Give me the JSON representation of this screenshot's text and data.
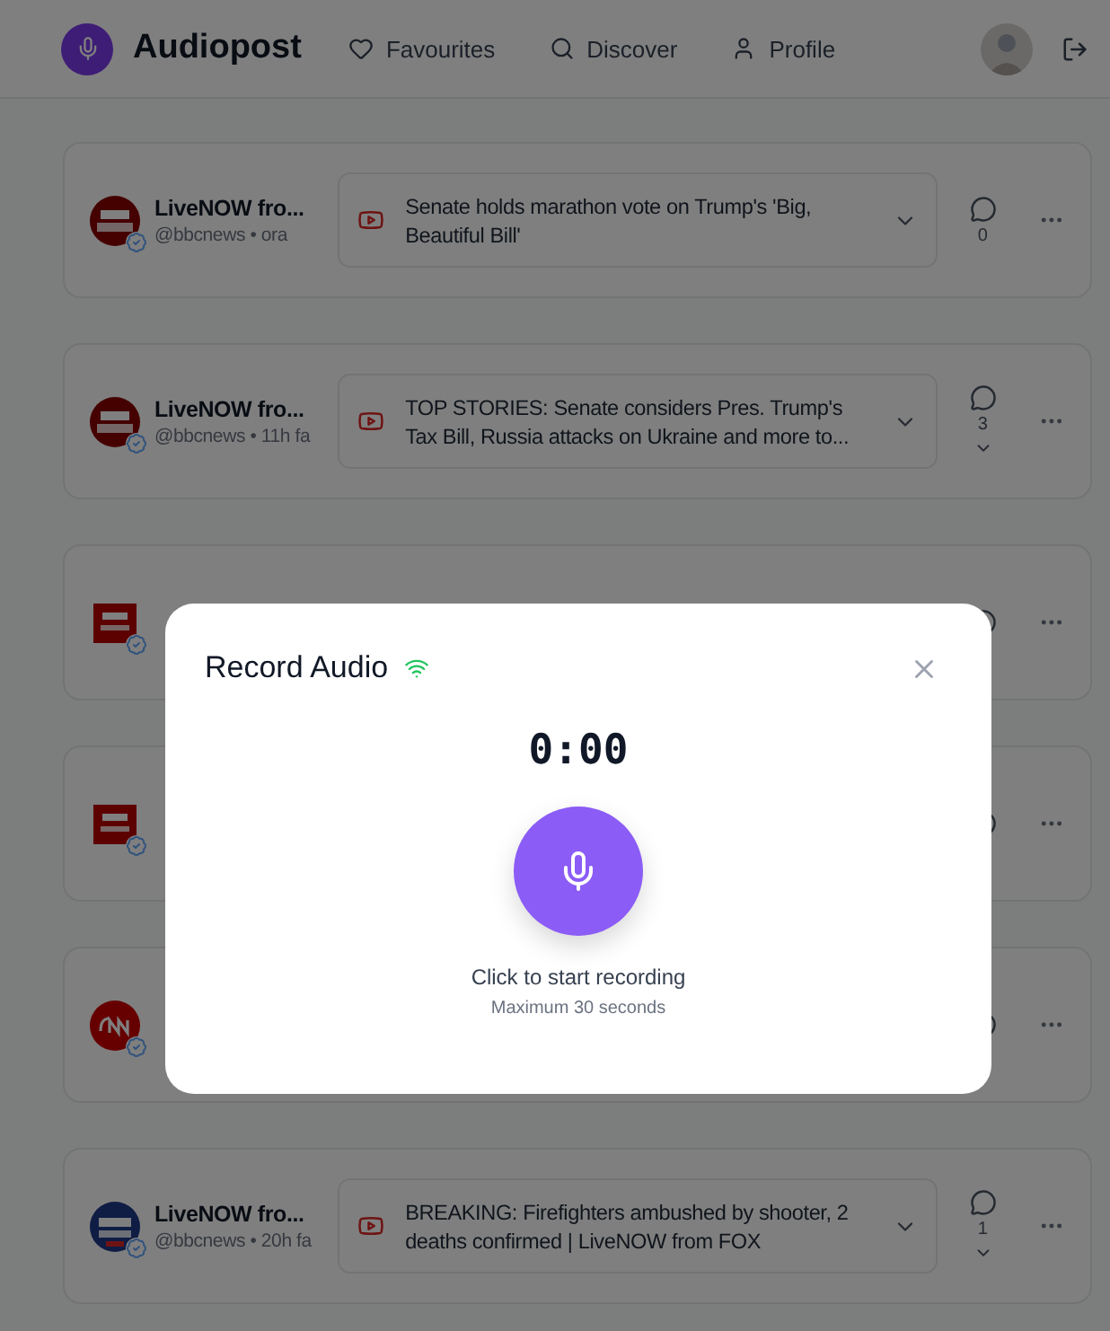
{
  "header": {
    "brand": "Audiopost",
    "nav": [
      {
        "label": "Favourites"
      },
      {
        "label": "Discover"
      },
      {
        "label": "Profile"
      }
    ]
  },
  "posts": [
    {
      "kind": "bbc-circle",
      "name": "LiveNOW fro...",
      "meta": "@bbcnews • ora",
      "headline": "Senate holds marathon vote on Trump's 'Big, Beautiful Bill'",
      "count": "0",
      "has_replies": false
    },
    {
      "kind": "bbc-circle",
      "name": "LiveNOW fro...",
      "meta": "@bbcnews • 11h fa",
      "headline": "TOP STORIES: Senate considers Pres. Trump's Tax Bill, Russia attacks on Ukraine and more to...",
      "count": "3",
      "has_replies": true
    },
    {
      "kind": "bbc-square",
      "has_replies": false
    },
    {
      "kind": "bbc-square",
      "has_replies": false
    },
    {
      "kind": "cnn",
      "has_replies": false
    },
    {
      "kind": "fox",
      "name": "LiveNOW fro...",
      "meta": "@bbcnews • 20h fa",
      "headline": "BREAKING: Firefighters ambushed by shooter, 2 deaths confirmed | LiveNOW from FOX",
      "count": "1",
      "has_replies": true
    }
  ],
  "dialog": {
    "title": "Record Audio",
    "connected": true,
    "timer": "0:00",
    "hint": "Click to start recording",
    "limit": "Maximum 30 seconds"
  }
}
